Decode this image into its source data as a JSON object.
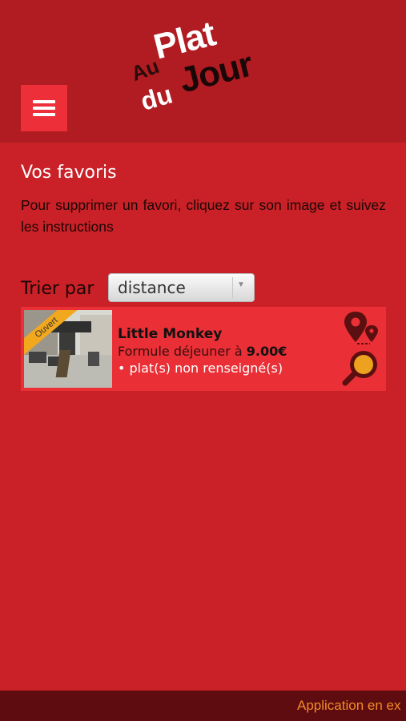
{
  "header": {
    "logo": {
      "au": "Au",
      "plat": "Plat",
      "du": "du",
      "jour": "Jour"
    },
    "menu_icon": "hamburger-icon"
  },
  "favorites": {
    "title": "Vos favoris",
    "instructions": "Pour supprimer un favori, cliquez sur son image et suivez les instructions"
  },
  "sort": {
    "label": "Trier par",
    "selected": "distance"
  },
  "restaurants": [
    {
      "status_badge": "Ouvert",
      "name": "Little Monkey",
      "formule_prefix": "Formule déjeuner à ",
      "price": "9.00€",
      "plats": "• plat(s) non renseigné(s)",
      "actions": [
        "map-pin-icon",
        "zoom-icon"
      ]
    }
  ],
  "footer": {
    "ticker": "Application en ex"
  },
  "colors": {
    "background": "#c92127",
    "header": "#b01c21",
    "card": "#ea2f36",
    "footer": "#5e0c0f",
    "badge": "#f2a81d",
    "ticker": "#f28c28"
  }
}
